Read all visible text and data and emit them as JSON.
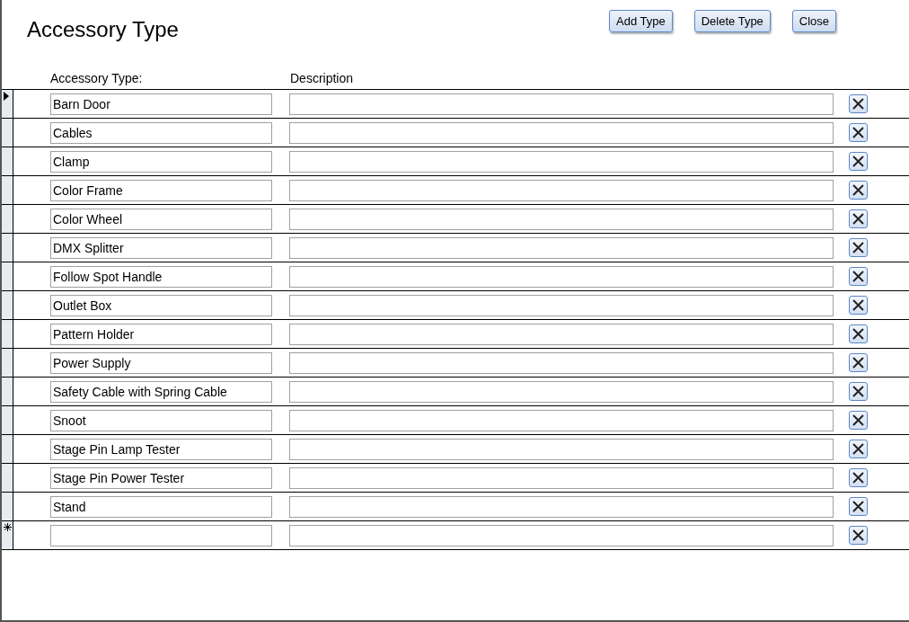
{
  "title": "Accessory Type",
  "buttons": [
    "Add Type",
    "Delete Type",
    "Close"
  ],
  "columns": [
    "Accessory Type:",
    "Description"
  ],
  "rows": [
    {
      "kind": "record",
      "current": true,
      "type": "Barn Door",
      "description": ""
    },
    {
      "kind": "record",
      "current": false,
      "type": "Cables",
      "description": ""
    },
    {
      "kind": "record",
      "current": false,
      "type": "Clamp",
      "description": ""
    },
    {
      "kind": "record",
      "current": false,
      "type": "Color Frame",
      "description": ""
    },
    {
      "kind": "record",
      "current": false,
      "type": "Color Wheel",
      "description": ""
    },
    {
      "kind": "record",
      "current": false,
      "type": "DMX Splitter",
      "description": ""
    },
    {
      "kind": "record",
      "current": false,
      "type": "Follow Spot Handle",
      "description": ""
    },
    {
      "kind": "record",
      "current": false,
      "type": "Outlet Box",
      "description": ""
    },
    {
      "kind": "record",
      "current": false,
      "type": "Pattern Holder",
      "description": ""
    },
    {
      "kind": "record",
      "current": false,
      "type": "Power Supply",
      "description": ""
    },
    {
      "kind": "record",
      "current": false,
      "type": "Safety Cable with Spring Cable",
      "description": ""
    },
    {
      "kind": "record",
      "current": false,
      "type": "Snoot",
      "description": ""
    },
    {
      "kind": "record",
      "current": false,
      "type": "Stage Pin Lamp Tester",
      "description": ""
    },
    {
      "kind": "record",
      "current": false,
      "type": "Stage Pin Power Tester",
      "description": ""
    },
    {
      "kind": "record",
      "current": false,
      "type": "Stand",
      "description": ""
    },
    {
      "kind": "new",
      "current": false,
      "type": "",
      "description": ""
    }
  ]
}
